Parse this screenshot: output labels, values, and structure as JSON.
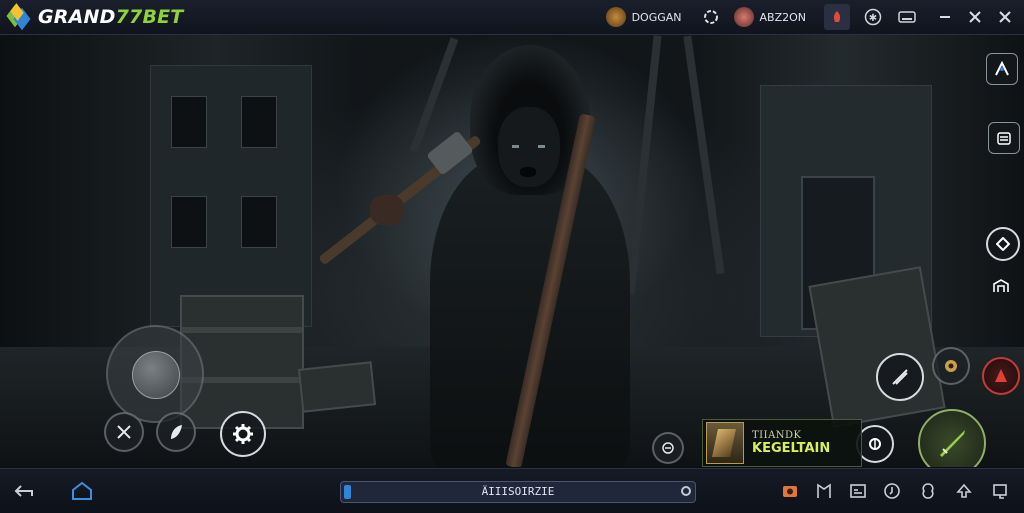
{
  "app": {
    "logo_text_main": "GRAND",
    "logo_text_accent": "77BET"
  },
  "topbar": {
    "player1_name": "DOGGAN",
    "player2_name": "ABZ2ON"
  },
  "game": {
    "profile": {
      "subtitle": "TIIANDK",
      "name": "KEGELTAIN"
    }
  },
  "bottombar": {
    "progress_text": "ÄIIISOIRZIE",
    "progress_fraction": 0.02
  },
  "icons": {
    "back": "back-arrow-icon",
    "home": "home-icon",
    "settings": "gear-icon",
    "map": "map-icon"
  },
  "colors": {
    "accent_blue": "#2f86d8",
    "accent_green": "#8fd23b",
    "profile_name": "#d9ef5a"
  }
}
